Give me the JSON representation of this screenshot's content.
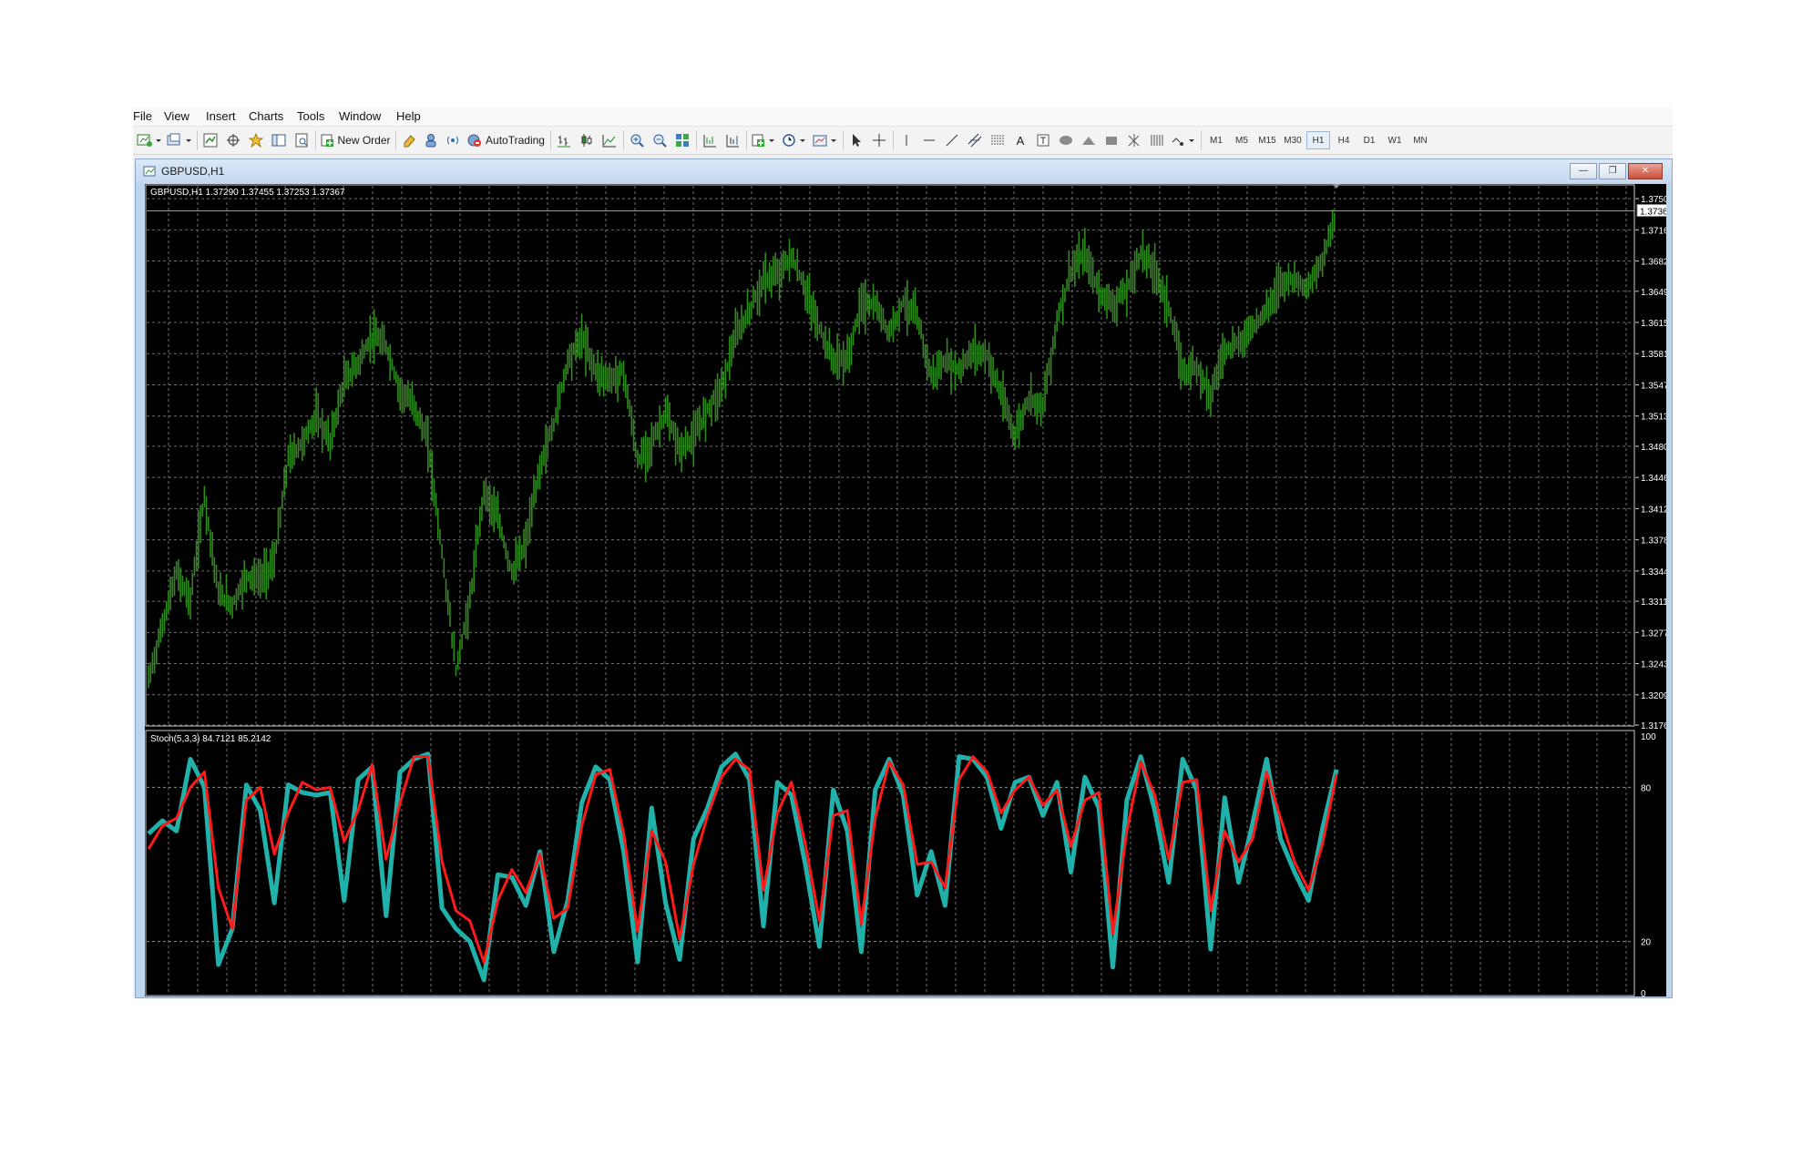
{
  "menubar": {
    "items": [
      "File",
      "View",
      "Insert",
      "Charts",
      "Tools",
      "Window",
      "Help"
    ]
  },
  "toolbar": {
    "new_order_label": "New Order",
    "autotrading_label": "AutoTrading",
    "timeframes": [
      "M1",
      "M5",
      "M15",
      "M30",
      "H1",
      "H4",
      "D1",
      "W1",
      "MN"
    ],
    "active_timeframe": "H1",
    "icons": [
      "new-chart-icon",
      "profiles-icon",
      "market-watch-icon",
      "data-window-icon",
      "navigator-icon",
      "terminal-icon",
      "strategy-tester-icon",
      "metaeditor-icon",
      "experts-icon",
      "signals-icon",
      "autotrading-icon",
      "bar-chart-icon",
      "candlesticks-icon",
      "line-chart-icon",
      "zoom-in-icon",
      "zoom-out-icon",
      "tile-windows-icon",
      "autoscroll-icon",
      "chart-shift-icon",
      "indicators-icon",
      "periods-icon",
      "templates-icon",
      "cursor-icon",
      "crosshair-icon",
      "vertical-line-icon",
      "horizontal-line-icon",
      "trendline-icon",
      "equidistant-channel-icon",
      "fibonacci-icon",
      "text-icon",
      "text-label-icon",
      "ellipse-icon",
      "triangle-icon",
      "rectangle-icon",
      "arrows-icon",
      "gann-icon",
      "more-objects-icon"
    ]
  },
  "window": {
    "title": "GBPUSD,H1"
  },
  "chart_data": [
    {
      "type": "bar",
      "title": "GBPUSD,H1  1.37290 1.37455 1.37253 1.37367",
      "symbol": "GBPUSD",
      "timeframe": "H1",
      "ohlc_label": {
        "open": 1.3729,
        "high": 1.37455,
        "low": 1.37253,
        "close": 1.37367
      },
      "last_price": 1.37367,
      "y_ticks": [
        1.375,
        1.3716,
        1.3682,
        1.3649,
        1.3615,
        1.3581,
        1.3547,
        1.3513,
        1.348,
        1.3446,
        1.3412,
        1.3378,
        1.3344,
        1.3311,
        1.3277,
        1.3243,
        1.3209,
        1.3176
      ],
      "y_tick_labels": [
        "1.37500",
        "1.37160",
        "1.36820",
        "1.36490",
        "1.36150",
        "1.35810",
        "1.35470",
        "1.35130",
        "1.34800",
        "1.34460",
        "1.34120",
        "1.33780",
        "1.33440",
        "1.33110",
        "1.32770",
        "1.32430",
        "1.32090",
        "1.31760"
      ],
      "last_price_label": "1.37367",
      "ylim": [
        1.3176,
        1.3764
      ],
      "grid": true,
      "bar_color": "#2e8b1a",
      "background": "#000000",
      "series": [
        {
          "values": [
            1.3225,
            1.3285,
            1.3341,
            1.3312,
            1.3427,
            1.332,
            1.3307,
            1.3339,
            1.3335,
            1.3355,
            1.3467,
            1.3484,
            1.3513,
            1.3485,
            1.3551,
            1.3571,
            1.36,
            1.3589,
            1.354,
            1.3525,
            1.3484,
            1.3364,
            1.3236,
            1.3311,
            1.3433,
            1.3401,
            1.3342,
            1.3374,
            1.3456,
            1.3505,
            1.3574,
            1.3599,
            1.3563,
            1.3552,
            1.3562,
            1.3463,
            1.3484,
            1.3516,
            1.3476,
            1.3489,
            1.3521,
            1.3544,
            1.3599,
            1.3628,
            1.3661,
            1.3667,
            1.3687,
            1.3651,
            1.3608,
            1.3574,
            1.3574,
            1.3636,
            1.3633,
            1.3604,
            1.3638,
            1.362,
            1.3556,
            1.3572,
            1.3563,
            1.3584,
            1.3579,
            1.3536,
            1.3491,
            1.3534,
            1.3524,
            1.3617,
            1.3672,
            1.3689,
            1.3649,
            1.3635,
            1.365,
            1.3692,
            1.3672,
            1.3632,
            1.3561,
            1.3568,
            1.3536,
            1.3586,
            1.3592,
            1.3611,
            1.3628,
            1.366,
            1.3663,
            1.3652,
            1.3683,
            1.3737
          ]
        }
      ]
    },
    {
      "type": "line",
      "title": "Stoch(5,3,3) 84.7121 85.2142",
      "main_value": 84.7121,
      "signal_value": 85.2142,
      "ylim": [
        0,
        100
      ],
      "y_ticks": [
        100,
        80,
        20,
        0
      ],
      "y_tick_labels": [
        "100",
        "80",
        "20",
        "0"
      ],
      "levels": [
        80,
        20
      ],
      "series": [
        {
          "color": "#20b2aa",
          "values": [
            62,
            67,
            63,
            91,
            80,
            11,
            25,
            81,
            71,
            35,
            81,
            78,
            77,
            78,
            36,
            83,
            88,
            30,
            86,
            91,
            93,
            33,
            25,
            20,
            5,
            46,
            45,
            34,
            55,
            16,
            36,
            74,
            88,
            83,
            55,
            12,
            72,
            35,
            13,
            60,
            72,
            88,
            93,
            83,
            26,
            82,
            77,
            50,
            18,
            79,
            63,
            16,
            79,
            91,
            77,
            38,
            55,
            34,
            92,
            91,
            84,
            64,
            82,
            84,
            69,
            82,
            47,
            84,
            72,
            10,
            75,
            92,
            71,
            43,
            91,
            79,
            17,
            76,
            43,
            66,
            91,
            60,
            47,
            36,
            64,
            87
          ]
        },
        {
          "color": "#ff1a1a",
          "values": [
            56,
            65,
            68,
            80,
            86,
            41,
            25,
            75,
            80,
            54,
            70,
            82,
            79,
            80,
            59,
            71,
            89,
            52,
            74,
            92,
            92,
            51,
            32,
            28,
            12,
            36,
            48,
            39,
            54,
            29,
            33,
            65,
            85,
            87,
            62,
            24,
            63,
            51,
            21,
            50,
            69,
            84,
            91,
            87,
            40,
            70,
            82,
            58,
            28,
            69,
            71,
            27,
            68,
            90,
            81,
            50,
            51,
            41,
            83,
            92,
            86,
            70,
            79,
            84,
            73,
            79,
            57,
            75,
            78,
            23,
            63,
            90,
            77,
            52,
            82,
            83,
            32,
            63,
            51,
            60,
            86,
            68,
            51,
            40,
            58,
            85
          ]
        }
      ]
    }
  ]
}
